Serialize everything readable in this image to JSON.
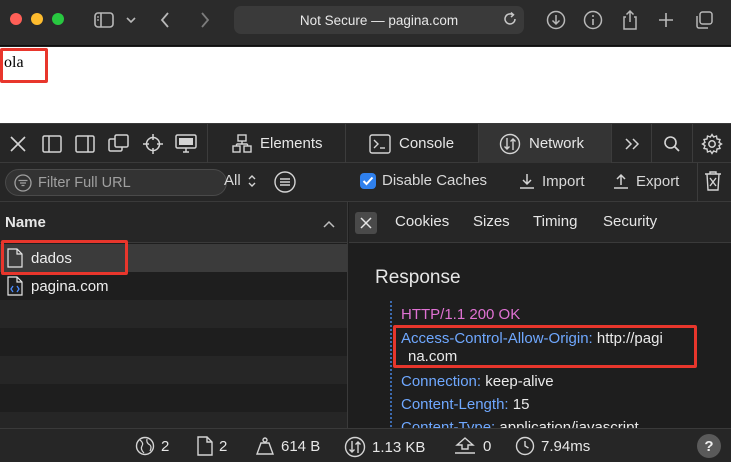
{
  "browser": {
    "address": "Not Secure — pagina.com"
  },
  "page": {
    "text": "ola"
  },
  "devtools": {
    "tabs": [
      {
        "label": "Elements"
      },
      {
        "label": "Console"
      },
      {
        "label": "Network"
      }
    ],
    "active_tab": "Network"
  },
  "filterbar": {
    "placeholder": "Filter Full URL",
    "type_filter": "All",
    "disable_caches": "Disable Caches",
    "import_label": "Import",
    "export_label": "Export"
  },
  "request_list": {
    "header": "Name",
    "rows": [
      {
        "name": "dados"
      },
      {
        "name": "pagina.com"
      }
    ]
  },
  "detail": {
    "tabs": [
      "Cookies",
      "Sizes",
      "Timing",
      "Security"
    ],
    "section_title": "Response",
    "status_line": "HTTP/1.1 200 OK",
    "headers": [
      {
        "key": "Access-Control-Allow-Origin:",
        "value_line1": "http://pagi",
        "value_line2": "na.com"
      },
      {
        "key": "Connection:",
        "value": "keep-alive"
      },
      {
        "key": "Content-Length:",
        "value": "15"
      },
      {
        "key": "Content-Type:",
        "value": "application/javascript"
      }
    ]
  },
  "summary": {
    "domains": "2",
    "resources": "2",
    "transferred": "614 B",
    "size": "1.13 KB",
    "time_other": "0",
    "duration": "7.94ms",
    "help": "?"
  },
  "colors": {
    "highlight": "#e8362c",
    "header_key": "#6fa8ff",
    "status_line": "#e072d4",
    "checkbox": "#2f80ed"
  }
}
